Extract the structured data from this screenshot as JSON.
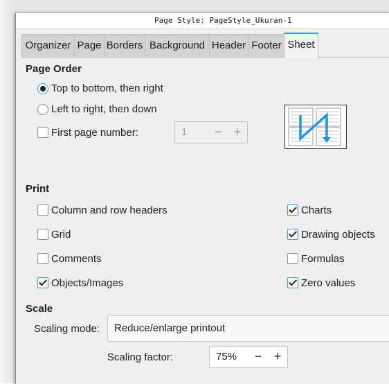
{
  "window": {
    "title": "Page Style: PageStyle_Ukuran-1"
  },
  "tabs": [
    {
      "label": "Organizer"
    },
    {
      "label": "Page"
    },
    {
      "label": "Borders"
    },
    {
      "label": "Background"
    },
    {
      "label": "Header"
    },
    {
      "label": "Footer"
    },
    {
      "label": "Sheet",
      "active": true
    }
  ],
  "page_order": {
    "title": "Page Order",
    "option_top_bottom": "Top to bottom, then right",
    "option_left_right": "Left to right, then down",
    "selected": "top_bottom",
    "first_page_label": "First page number:",
    "first_page_checked": false,
    "first_page_value": "1",
    "minus": "−",
    "plus": "+"
  },
  "print": {
    "title": "Print",
    "items": [
      {
        "label": "Column and row headers",
        "checked": false
      },
      {
        "label": "Grid",
        "checked": false
      },
      {
        "label": "Comments",
        "checked": false
      },
      {
        "label": "Objects/Images",
        "checked": true
      },
      {
        "label": "Charts",
        "checked": true
      },
      {
        "label": "Drawing objects",
        "checked": true
      },
      {
        "label": "Formulas",
        "checked": false
      },
      {
        "label": "Zero values",
        "checked": true
      }
    ]
  },
  "scale": {
    "title": "Scale",
    "mode_label": "Scaling mode:",
    "mode_value": "Reduce/enlarge printout",
    "factor_label": "Scaling factor:",
    "factor_value": "75%",
    "minus": "−",
    "plus": "+"
  },
  "colors": {
    "accent": "#2ea2df",
    "preview_arrow": "#2196d9"
  }
}
